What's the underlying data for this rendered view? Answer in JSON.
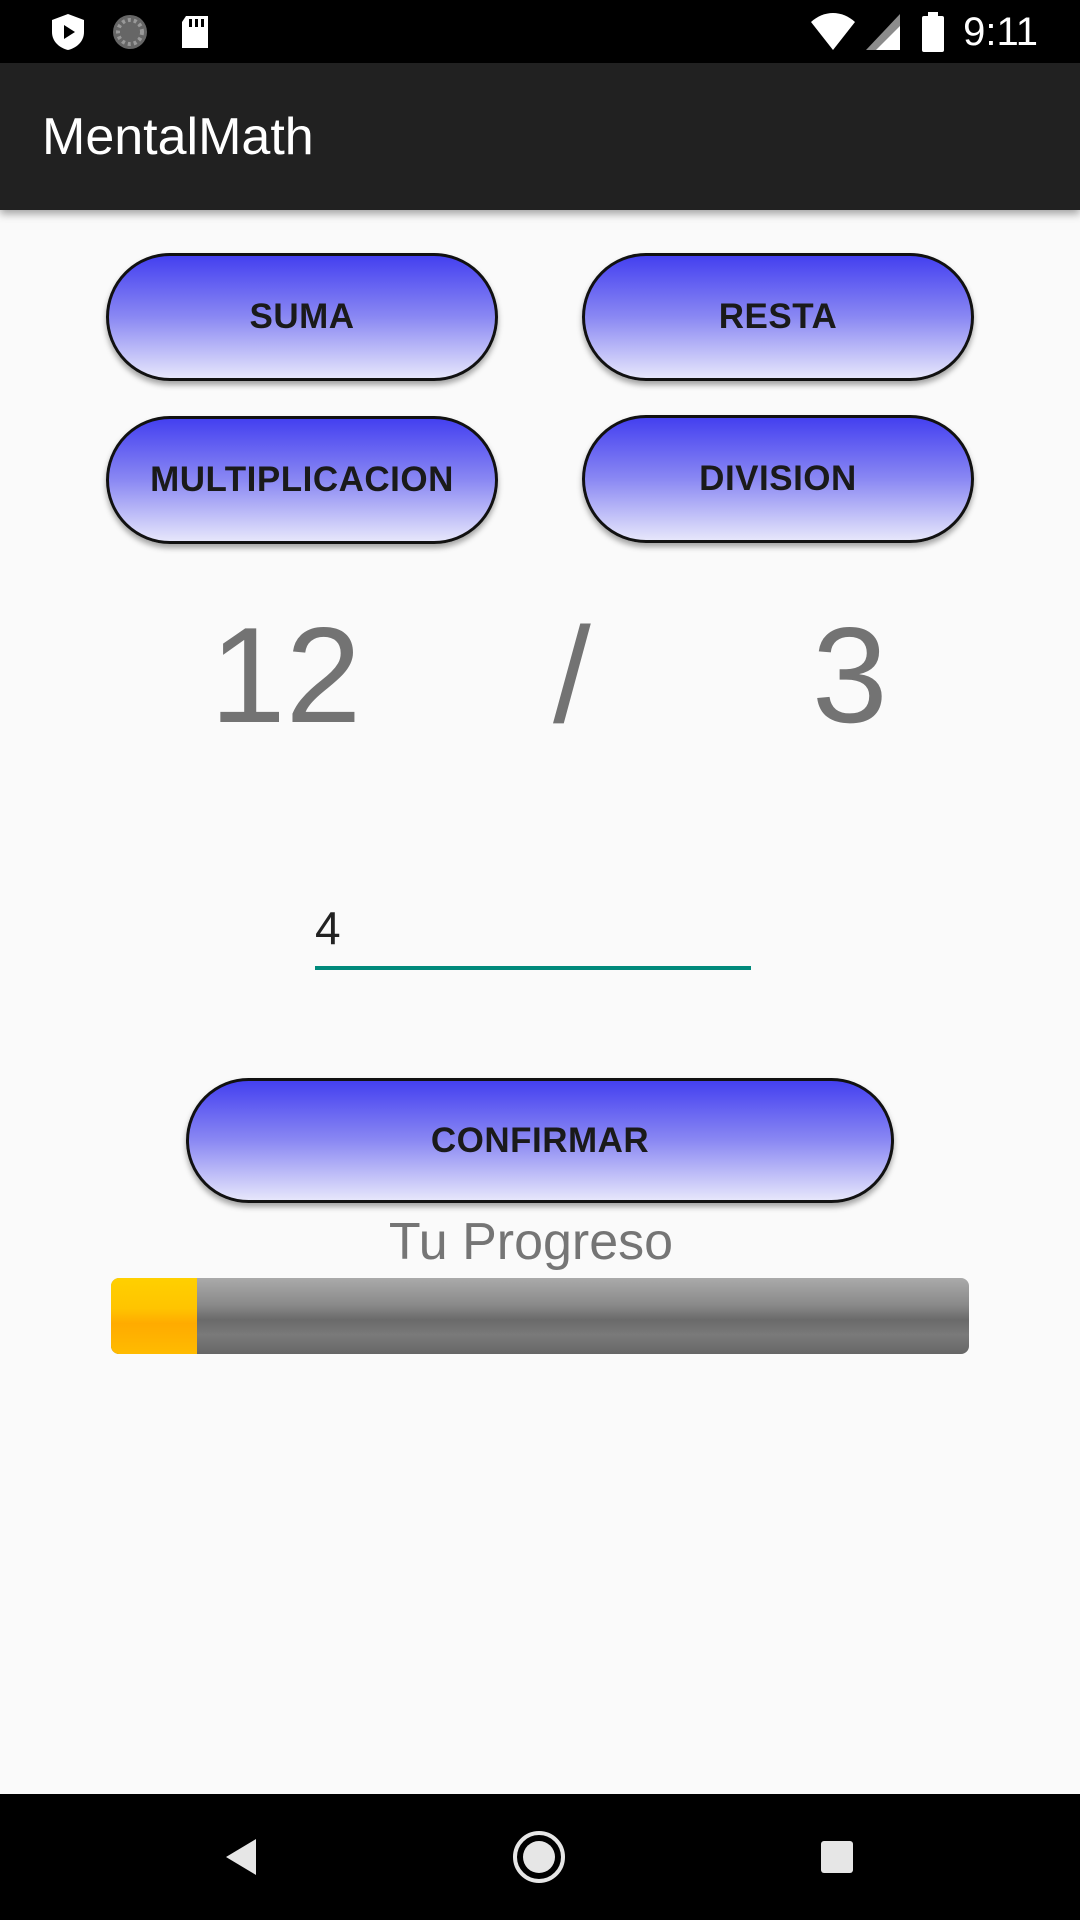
{
  "status_bar": {
    "time": "9:11",
    "left_icons": [
      "shield-play-icon",
      "sync-icon",
      "sd-card-icon"
    ],
    "right_icons": [
      "wifi-icon",
      "signal-icon",
      "battery-icon"
    ]
  },
  "app_bar": {
    "title": "MentalMath"
  },
  "operations": {
    "suma_label": "SUMA",
    "resta_label": "RESTA",
    "multiplicacion_label": "MULTIPLICACION",
    "division_label": "DIVISION"
  },
  "problem": {
    "operand_a": "12",
    "operator": "/",
    "operand_b": "3"
  },
  "answer": {
    "value": "4"
  },
  "confirm": {
    "label": "CONFIRMAR"
  },
  "progress": {
    "label": "Tu Progreso",
    "fraction": 0.1,
    "track_color": "#7a7a7a",
    "fill_color": "#ffc400"
  },
  "colors": {
    "button_gradient_top": "#4440f0",
    "button_gradient_bottom": "#e6e6fb",
    "input_underline": "#00897b",
    "app_bar": "#212121"
  },
  "nav_bar": {
    "buttons": [
      "back-icon",
      "home-icon",
      "recents-icon"
    ]
  }
}
